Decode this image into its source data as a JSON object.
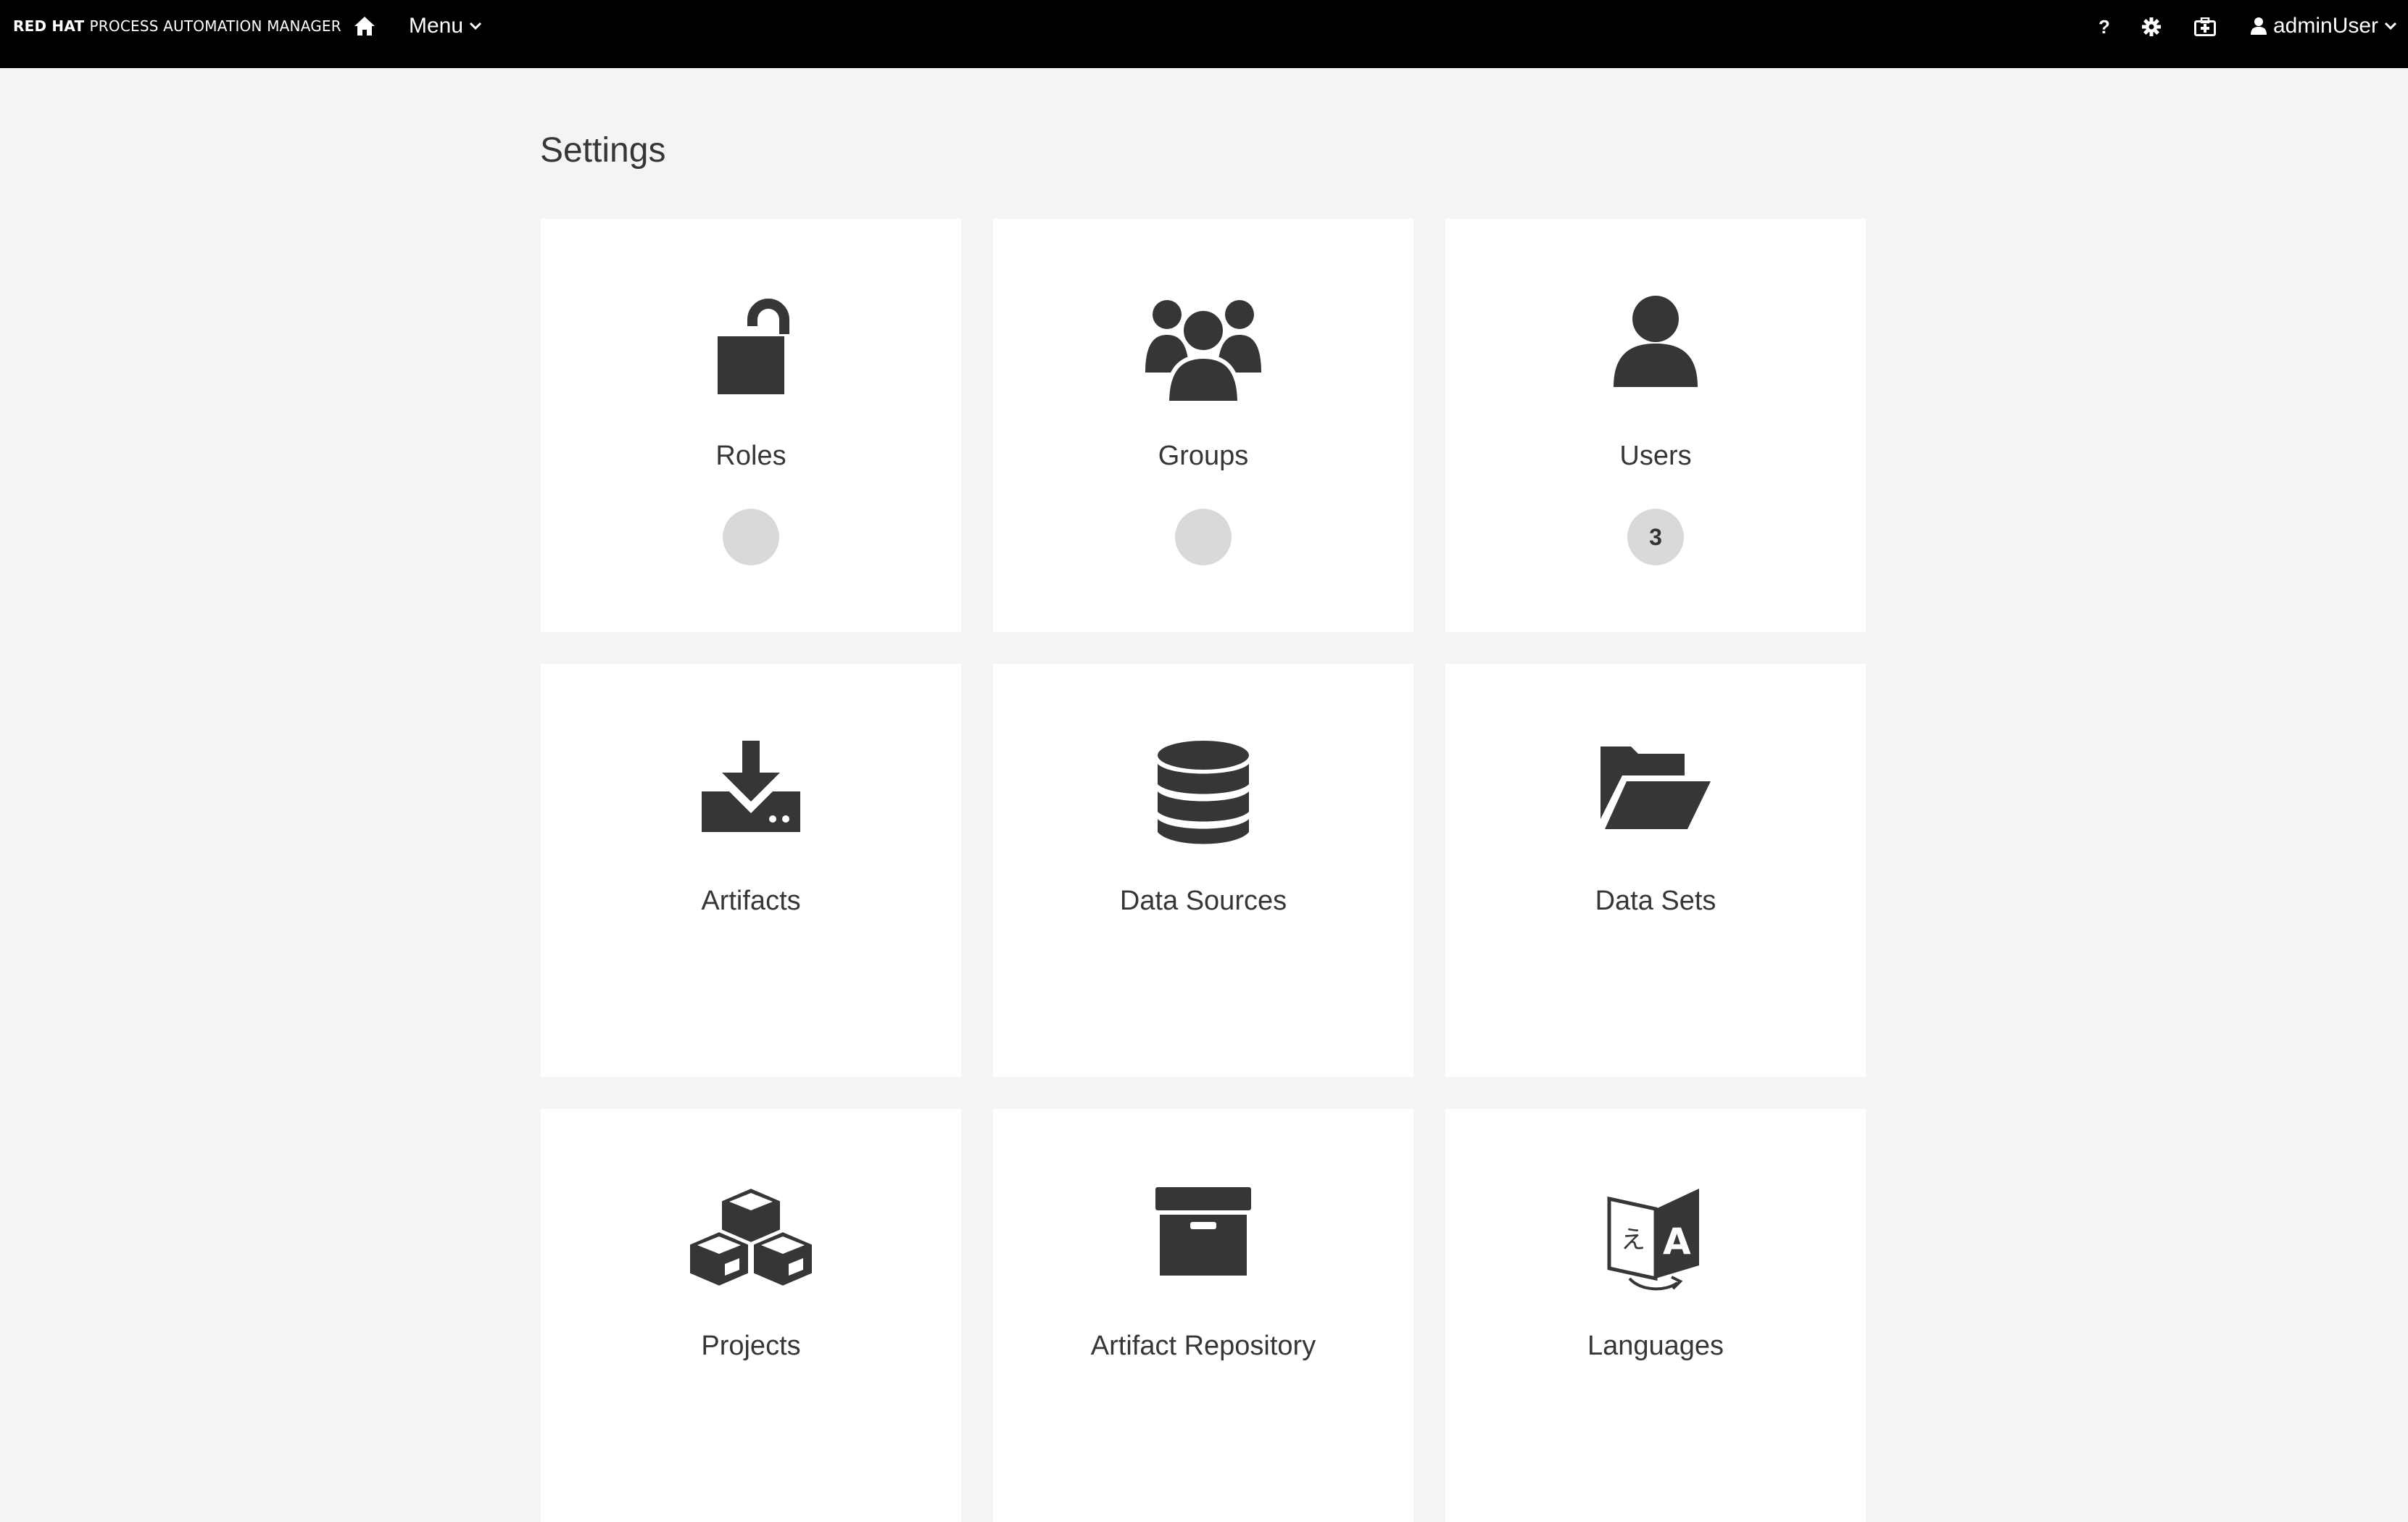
{
  "header": {
    "brand_bold": "RED HAT",
    "brand_rest": "PROCESS AUTOMATION MANAGER",
    "menu_label": "Menu",
    "help_label": "?",
    "user_label": "adminUser"
  },
  "page": {
    "title": "Settings"
  },
  "cards": [
    {
      "label": "Roles",
      "icon": "unlock-icon",
      "badge": ""
    },
    {
      "label": "Groups",
      "icon": "users-group-icon",
      "badge": ""
    },
    {
      "label": "Users",
      "icon": "user-icon",
      "badge": "3"
    },
    {
      "label": "Artifacts",
      "icon": "download-icon"
    },
    {
      "label": "Data Sources",
      "icon": "database-icon"
    },
    {
      "label": "Data Sets",
      "icon": "folder-open-icon"
    },
    {
      "label": "Projects",
      "icon": "cubes-icon"
    },
    {
      "label": "Artifact Repository",
      "icon": "archive-icon"
    },
    {
      "label": "Languages",
      "icon": "language-icon"
    }
  ],
  "colors": {
    "topbar": "#000000",
    "background": "#f4f4f4",
    "card": "#ffffff",
    "icon": "#363636",
    "badge": "#d9d9d9"
  }
}
